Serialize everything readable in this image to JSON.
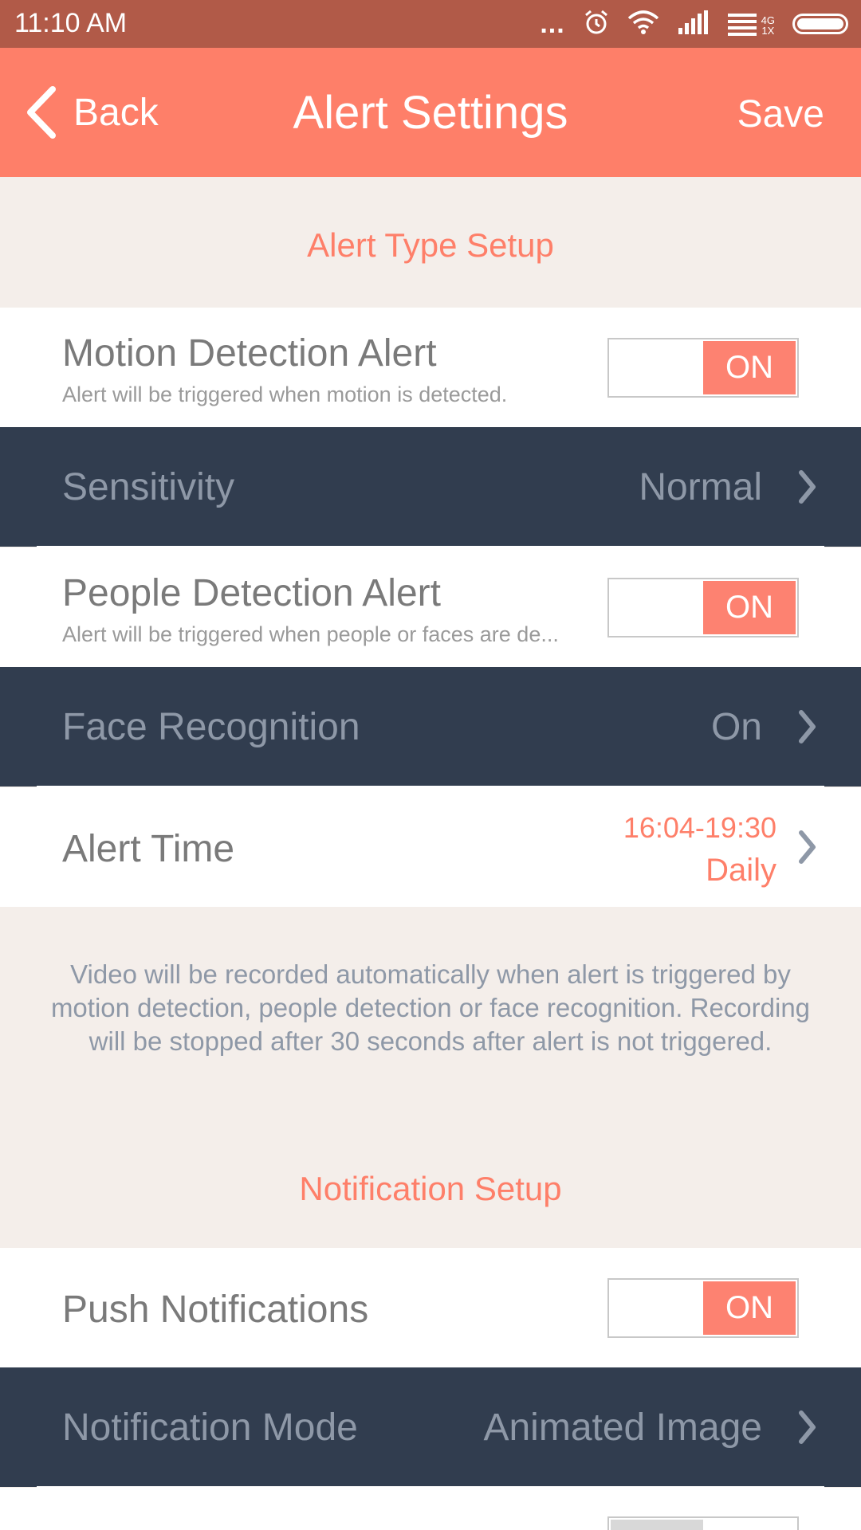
{
  "status_bar": {
    "time": "11:10 AM",
    "dots": "...",
    "network_labels": [
      "4G",
      "1X"
    ]
  },
  "app_bar": {
    "back_label": "Back",
    "title": "Alert Settings",
    "save_label": "Save"
  },
  "sections": {
    "alert_type": "Alert Type Setup",
    "notification": "Notification Setup"
  },
  "rows": {
    "motion": {
      "title": "Motion Detection Alert",
      "subtitle": "Alert will be triggered when motion is detected.",
      "toggle": "ON"
    },
    "sensitivity": {
      "title": "Sensitivity",
      "value": "Normal"
    },
    "people": {
      "title": "People Detection Alert",
      "subtitle": "Alert will be triggered when people or faces are de...",
      "toggle": "ON"
    },
    "face": {
      "title": "Face Recognition",
      "value": "On"
    },
    "alert_time": {
      "title": "Alert Time",
      "time_range": "16:04-19:30",
      "repeat": "Daily"
    },
    "push": {
      "title": "Push Notifications",
      "toggle": "ON"
    },
    "mode": {
      "title": "Notification Mode",
      "value": "Animated Image"
    }
  },
  "info": "Video will be recorded automatically when alert is triggered by motion detection, people detection or face recognition. Recording will be stopped after 30 seconds after alert is not triggered.",
  "colors": {
    "status_bar": "#b15a48",
    "app_bar": "#fe7f69",
    "accent": "#fe7f69",
    "dark_row": "#313d4f",
    "background": "#f4eeea"
  }
}
